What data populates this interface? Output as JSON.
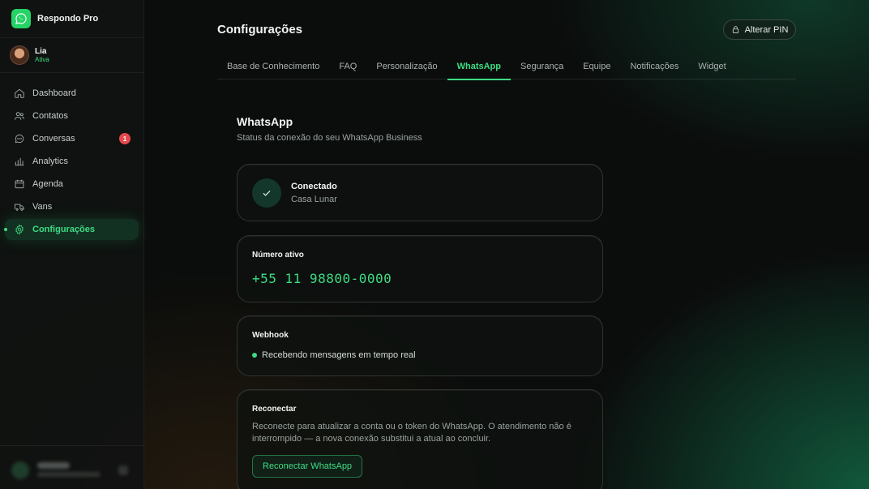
{
  "app": {
    "name": "Respondo Pro"
  },
  "user": {
    "name": "Lia",
    "status": "Ativa"
  },
  "nav": {
    "items": [
      {
        "label": "Dashboard",
        "icon": "home-icon"
      },
      {
        "label": "Contatos",
        "icon": "users-icon"
      },
      {
        "label": "Conversas",
        "icon": "chat-icon",
        "badge": "1"
      },
      {
        "label": "Analytics",
        "icon": "bar-chart-icon"
      },
      {
        "label": "Agenda",
        "icon": "calendar-icon"
      },
      {
        "label": "Vans",
        "icon": "van-icon"
      },
      {
        "label": "Configurações",
        "icon": "gear-icon",
        "active": true
      }
    ]
  },
  "header": {
    "title": "Configurações",
    "pin_button": "Alterar PIN"
  },
  "tabs": [
    {
      "label": "Base de Conhecimento"
    },
    {
      "label": "FAQ"
    },
    {
      "label": "Personalização"
    },
    {
      "label": "WhatsApp",
      "active": true
    },
    {
      "label": "Segurança"
    },
    {
      "label": "Equipe"
    },
    {
      "label": "Notificações"
    },
    {
      "label": "Widget"
    }
  ],
  "section": {
    "title": "WhatsApp",
    "subtitle": "Status da conexão do seu WhatsApp Business"
  },
  "connection": {
    "status": "Conectado",
    "account": "Casa Lunar"
  },
  "number_card": {
    "label": "Número ativo",
    "number": "+55 11 98800-0000"
  },
  "webhook": {
    "label": "Webhook",
    "status": "Recebendo mensagens em tempo real"
  },
  "reconnect": {
    "label": "Reconectar",
    "description": "Reconecte para atualizar a conta ou o token do WhatsApp. O atendimento não é interrompido — a nova conexão substitui a atual ao concluir.",
    "button": "Reconectar WhatsApp"
  },
  "colors": {
    "accent": "#3ddc84",
    "badge": "#e5484d",
    "brand": "#25d366"
  }
}
